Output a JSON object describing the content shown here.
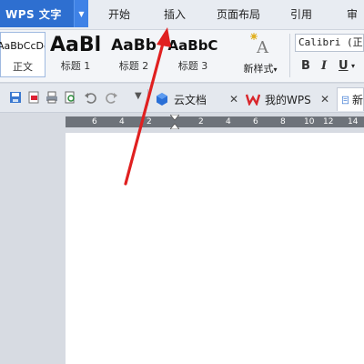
{
  "app": {
    "name": "WPS 文字",
    "brand_color": "#2e6fd0"
  },
  "menu": {
    "tabs": [
      {
        "label": "开始"
      },
      {
        "label": "插入"
      },
      {
        "label": "页面布局"
      },
      {
        "label": "引用"
      },
      {
        "label": "审阅"
      }
    ]
  },
  "ribbon": {
    "styles": [
      {
        "sample": "AaBbCcDd",
        "label": "正文"
      },
      {
        "sample": "AaBl",
        "label": "标题 1"
      },
      {
        "sample": "AaBb",
        "label": "标题 2"
      },
      {
        "sample": "AaBbC",
        "label": "标题 3"
      }
    ],
    "new_style": {
      "label": "新样式",
      "icon": "new-style-icon"
    },
    "font": {
      "name": "Calibri (正文"
    },
    "format_buttons": [
      "B",
      "I",
      "U"
    ]
  },
  "quickbar": {
    "icons": [
      "save-icon",
      "export-pdf-icon",
      "print-icon",
      "print-preview-icon",
      "undo-icon",
      "redo-icon"
    ],
    "doc_tabs": [
      {
        "label": "云文档"
      },
      {
        "label": "我的WPS"
      },
      {
        "label": "新"
      }
    ]
  },
  "ruler": {
    "ticks": [
      "6",
      "4",
      "2",
      "2",
      "4",
      "6",
      "8",
      "10",
      "12",
      "14"
    ]
  },
  "annotation": {
    "arrow_color": "#e02020",
    "target": "插入"
  }
}
